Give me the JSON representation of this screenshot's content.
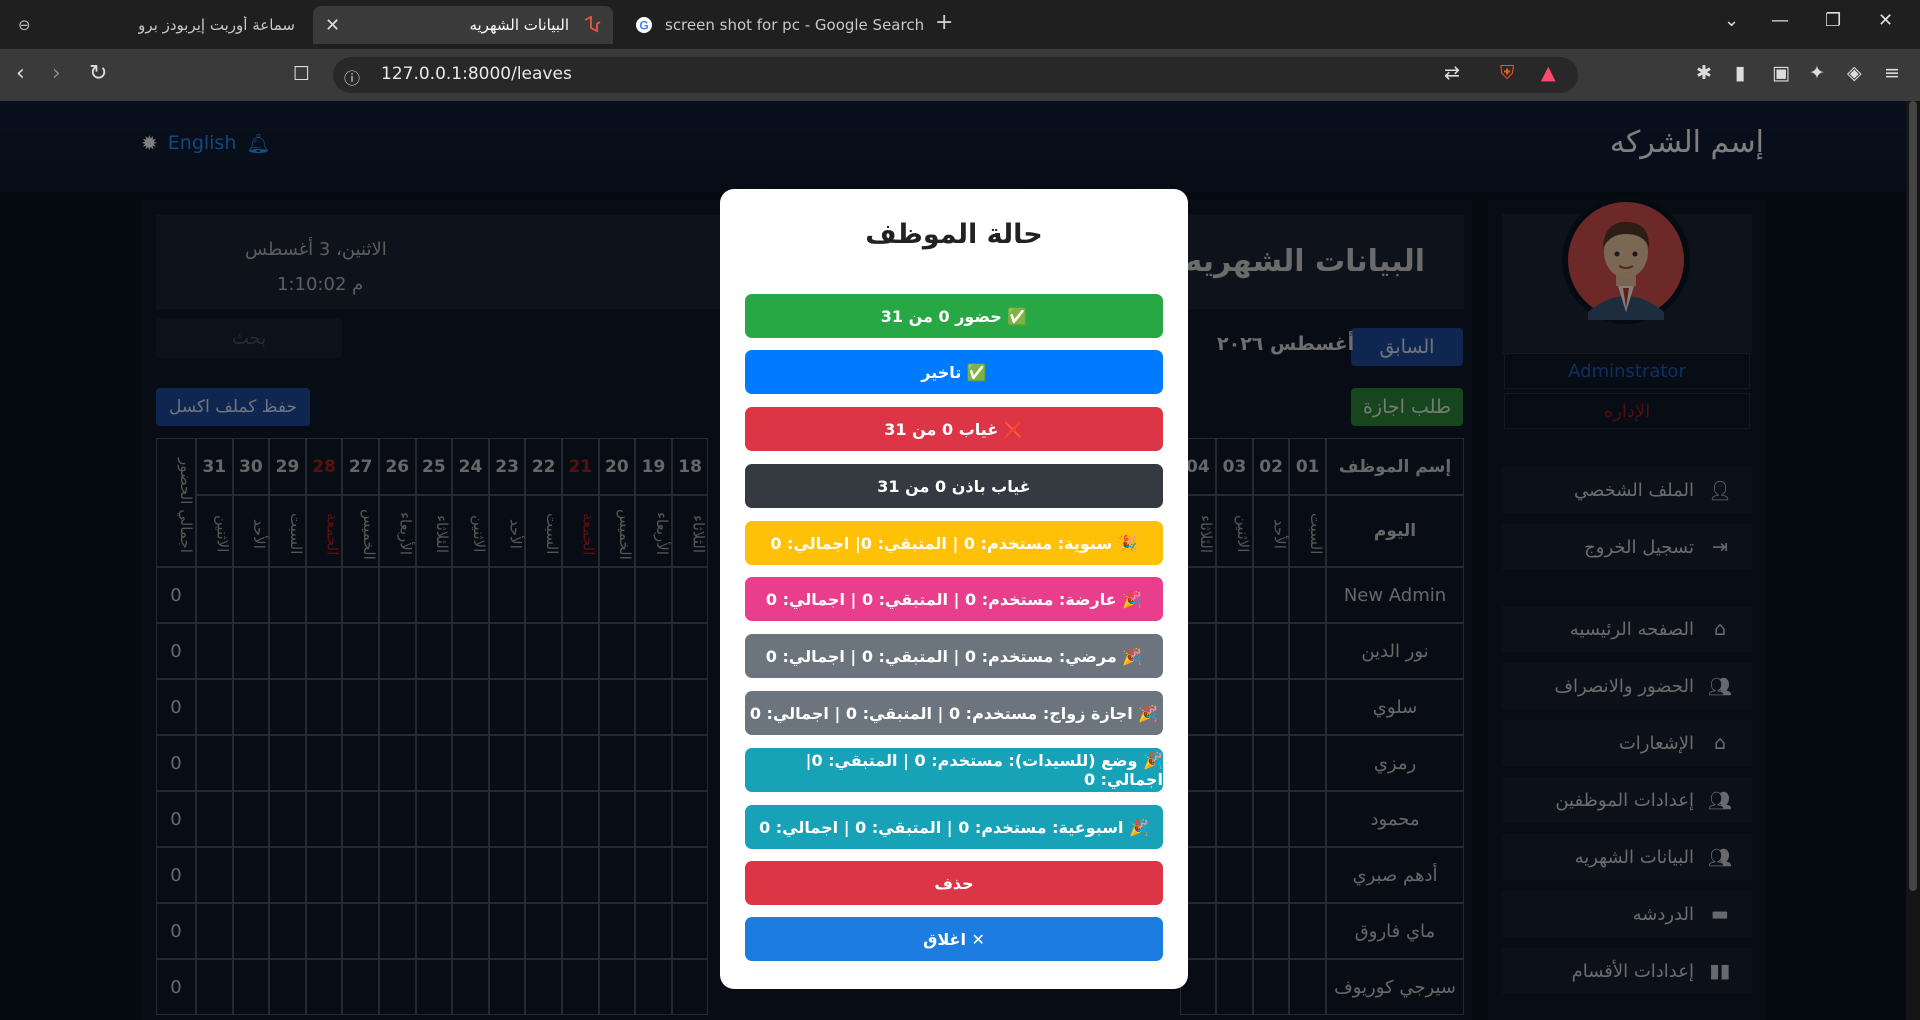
{
  "browser": {
    "tabs": [
      {
        "title": "سماعة أوربت إيربودز برو",
        "icon": "globe-icon"
      },
      {
        "title": "البيانات الشهريه",
        "icon": "laravel-icon",
        "active": true
      },
      {
        "title": "screen shot for pc - Google Search",
        "icon": "google-icon"
      }
    ],
    "url": "127.0.0.1:8000/leaves"
  },
  "header": {
    "brand": "إسم الشركه",
    "language": "English"
  },
  "page": {
    "title": "البيانات الشهريه",
    "date": "الاثنين، 3 أغسطس",
    "time": "1:10:02 م",
    "search_placeholder": "بحث",
    "prev_label": "السابق",
    "month_label": "أغسطس ٢٠٢٦",
    "leave_request_label": "طلب اجازة",
    "export_label": "حفظ كملف اكسل"
  },
  "grid": {
    "name_header": "إسم الموظف",
    "day_header": "اليوم",
    "total_header": "اجمالي الحضور",
    "right_days": [
      {
        "num": "01",
        "day": "السبت"
      },
      {
        "num": "02",
        "day": "الأحد"
      },
      {
        "num": "03",
        "day": "الاثنين"
      },
      {
        "num": "04",
        "day": "الثلاثاء"
      }
    ],
    "left_days": [
      {
        "num": "18",
        "day": "الثلاثاء"
      },
      {
        "num": "19",
        "day": "الأربعاء"
      },
      {
        "num": "20",
        "day": "الخميس"
      },
      {
        "num": "21",
        "day": "الجمعة",
        "friday": true
      },
      {
        "num": "22",
        "day": "السبت"
      },
      {
        "num": "23",
        "day": "الأحد"
      },
      {
        "num": "24",
        "day": "الاثنين"
      },
      {
        "num": "25",
        "day": "الثلاثاء"
      },
      {
        "num": "26",
        "day": "الأربعاء"
      },
      {
        "num": "27",
        "day": "الخميس"
      },
      {
        "num": "28",
        "day": "الجمعة",
        "friday": true
      },
      {
        "num": "29",
        "day": "السبت"
      },
      {
        "num": "30",
        "day": "الأحد"
      },
      {
        "num": "31",
        "day": "الاثنين"
      }
    ],
    "employees": [
      {
        "name": "New Admin",
        "total": "0"
      },
      {
        "name": "نور الدين",
        "total": "0"
      },
      {
        "name": "سلوي",
        "total": "0"
      },
      {
        "name": "رمزي",
        "total": "0"
      },
      {
        "name": "محمود",
        "total": "0"
      },
      {
        "name": "أدهم صبري",
        "total": "0"
      },
      {
        "name": "ماي فاروق",
        "total": "0"
      },
      {
        "name": "سيرجي كوريوف",
        "total": "0"
      }
    ]
  },
  "sidebar": {
    "user_name": "Adminstrator",
    "user_role": "الإداره",
    "items": [
      {
        "label": "الملف الشخصي",
        "icon": "user-edit-icon"
      },
      {
        "label": "تسجيل الخروج",
        "icon": "logout-icon"
      },
      {
        "label": "الصفحه الرئيسيه",
        "icon": "home-icon"
      },
      {
        "label": "الحضور والانصراف",
        "icon": "users-icon"
      },
      {
        "label": "الإشعارات",
        "icon": "home-icon"
      },
      {
        "label": "إعدادات الموظفين",
        "icon": "users-icon"
      },
      {
        "label": "البيانات الشهريه",
        "icon": "users-icon"
      },
      {
        "label": "الدردشه",
        "icon": "chat-icon"
      },
      {
        "label": "إعدادات الأقسام",
        "icon": "chart-icon"
      }
    ]
  },
  "modal": {
    "title": "حالة الموظف",
    "buttons": [
      {
        "text": "✅ حضور 0 من 31",
        "color": "#28a745"
      },
      {
        "text": "✅ تاخير",
        "color": "#007bff"
      },
      {
        "text": "❌ غياب 0 من 31",
        "color": "#dc3545"
      },
      {
        "text": "غياب باذن 0 من 31",
        "color": "#343a40"
      },
      {
        "text": "🎉 سنوية: مستخدم: 0 | المتبقي: 0| اجمالي: 0",
        "color": "#ffc107"
      },
      {
        "text": "🎉 عارضة: مستخدم: 0 | المتبقي: 0 | اجمالي: 0",
        "color": "#e83e8c"
      },
      {
        "text": "🎉 مرضي: مستخدم: 0 | المتبقي: 0 | اجمالي: 0",
        "color": "#6c757d"
      },
      {
        "text": "🎉 اجازة زواج: مستخدم: 0 | المتبقي: 0 | اجمالي: 0",
        "color": "#6c757d"
      },
      {
        "text": "🎉 وضع (للسيدات): مستخدم: 0 | المتبقي: 0| اجمالي: 0",
        "color": "#17a2b8"
      },
      {
        "text": "🎉 اسبوعية: مستخدم: 0 | المتبقي: 0 | اجمالي: 0",
        "color": "#17a2b8"
      },
      {
        "text": "حذف",
        "color": "#dc3545"
      },
      {
        "text": "✕ اغلاق",
        "color": "#1c7ce0"
      }
    ]
  }
}
